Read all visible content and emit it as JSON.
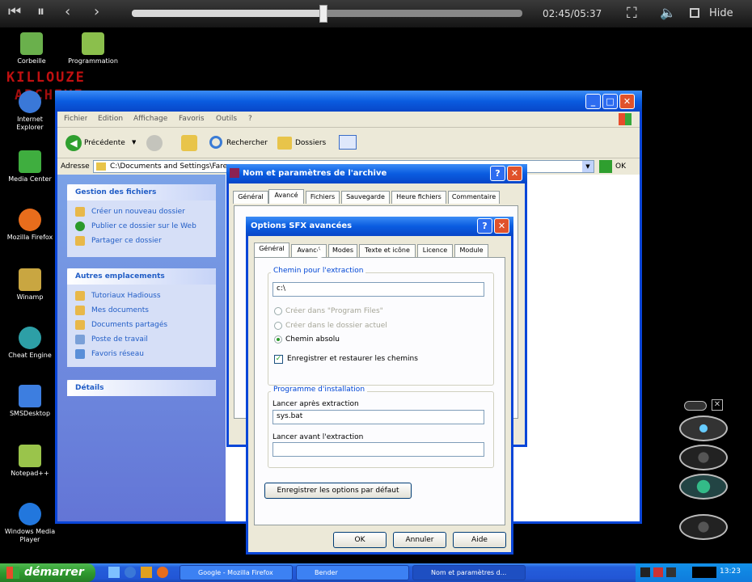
{
  "player": {
    "time": "02:45/05:37",
    "hide_label": "Hide",
    "progress": 0.49
  },
  "watermark": {
    "line1": "KILLOUZE",
    "line2": "ARCHIVE"
  },
  "desktop": [
    {
      "label": "Corbeille",
      "color": "#6ab04c"
    },
    {
      "label": "Programmation",
      "color": "#8bbf4c"
    },
    {
      "label": "Internet Explorer",
      "color": "#3a78d8"
    },
    {
      "label": "Media Center",
      "color": "#3fae3f"
    },
    {
      "label": "Mozilla Firefox",
      "color": "#e86d1c"
    },
    {
      "label": "Winamp",
      "color": "#c9a641"
    },
    {
      "label": "Cheat Engine",
      "color": "#2d9fa6"
    },
    {
      "label": "SMSDesktop",
      "color": "#3d7ee0"
    },
    {
      "label": "Notepad++",
      "color": "#9ac44b"
    },
    {
      "label": "Windows Media Player",
      "color": "#2277dd"
    }
  ],
  "explorer": {
    "menu": [
      "Fichier",
      "Edition",
      "Affichage",
      "Favoris",
      "Outils",
      "?"
    ],
    "toolbar": {
      "back": "Précédente",
      "search": "Rechercher",
      "folders": "Dossiers"
    },
    "address_label": "Adresse",
    "address_value": "C:\\Documents and Settings\\Fare",
    "go_label": "OK",
    "panels": {
      "files": {
        "title": "Gestion des fichiers",
        "items": [
          "Créer un nouveau dossier",
          "Publier ce dossier sur le Web",
          "Partager ce dossier"
        ]
      },
      "places": {
        "title": "Autres emplacements",
        "items": [
          "Tutoriaux Hadiouss",
          "Mes documents",
          "Documents partagés",
          "Poste de travail",
          "Favoris réseau"
        ]
      },
      "details": {
        "title": "Détails"
      }
    }
  },
  "archive_dialog": {
    "title": "Nom et paramètres de l'archive",
    "tabs": [
      "Général",
      "Avancé",
      "Fichiers",
      "Sauvegarde",
      "Heure fichiers",
      "Commentaire"
    ],
    "selected_tab": "Avancé"
  },
  "sfx_dialog": {
    "title": "Options SFX avancées",
    "tabs": [
      "Général",
      "Avancé",
      "Modes",
      "Texte et icône",
      "Licence",
      "Module"
    ],
    "extract_group": "Chemin pour l'extraction",
    "extract_path": "c:\\",
    "radio_program_files": "Créer dans \"Program Files\"",
    "radio_current": "Créer dans le dossier actuel",
    "radio_absolute": "Chemin absolu",
    "checkbox_save": "Enregistrer et restaurer les chemins",
    "setup_group": "Programme d'installation",
    "run_after_label": "Lancer après extraction",
    "run_after_value": "sys.bat",
    "run_before_label": "Lancer avant l'extraction",
    "run_before_value": "",
    "save_defaults": "Enregistrer les options par défaut",
    "ok": "OK",
    "cancel": "Annuler",
    "help": "Aide"
  },
  "taskbar": {
    "start": "démarrer",
    "tasks": [
      "Google - Mozilla Firefox",
      "Bender",
      "Nom et paramètres d..."
    ],
    "clock": "13:23"
  }
}
